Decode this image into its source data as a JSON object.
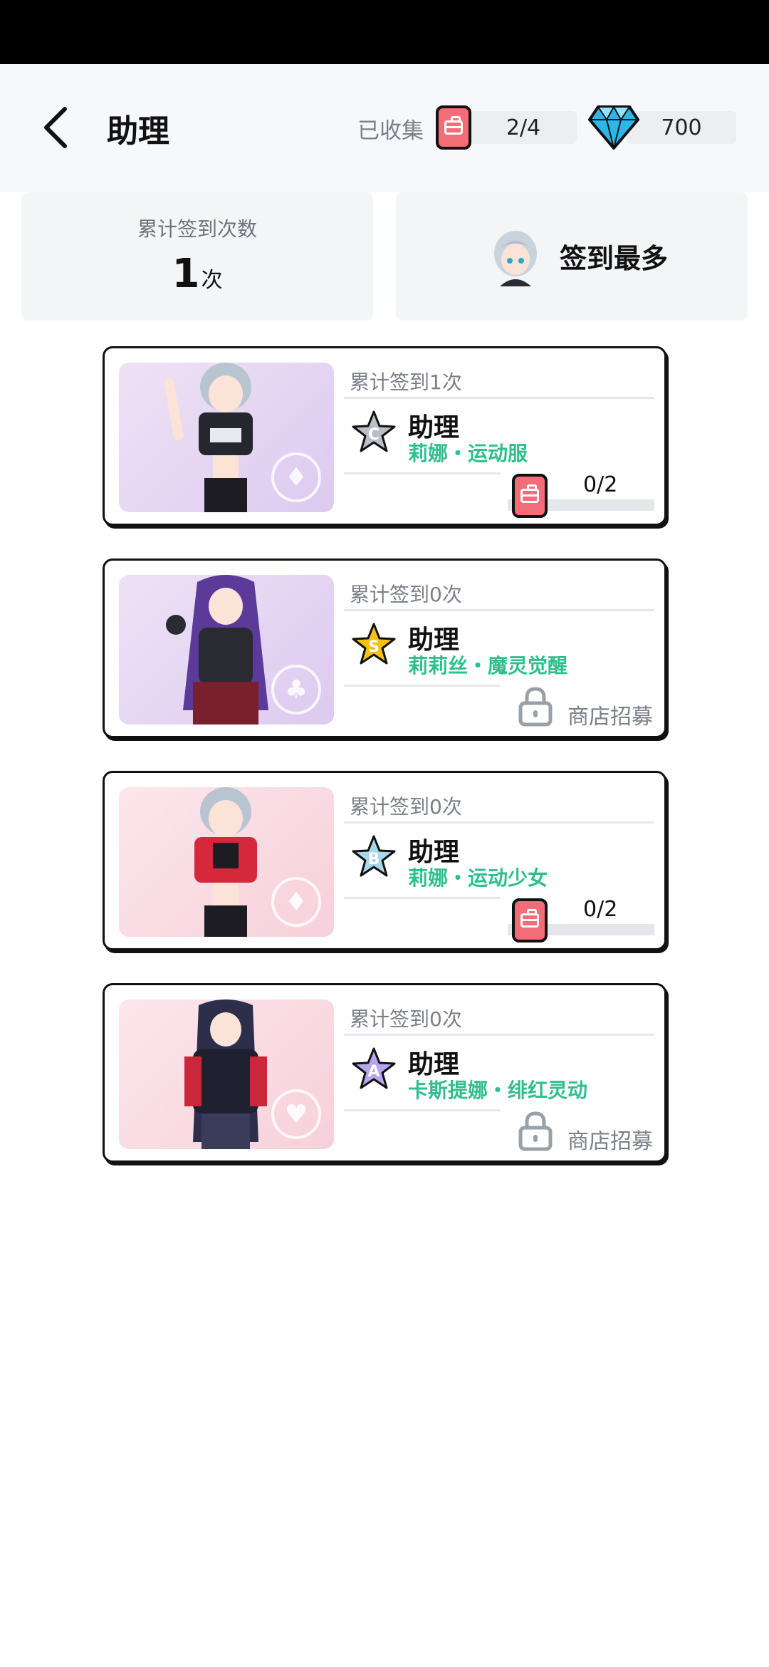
{
  "header": {
    "title": "助理",
    "collected_label": "已收集",
    "collected_count": "2/4",
    "diamonds": "700"
  },
  "stats": {
    "total_label": "累计签到次数",
    "total_value": "1",
    "total_unit": "次",
    "most_label": "签到最多"
  },
  "cards": [
    {
      "count_text": "累计签到1次",
      "rank": "C",
      "title": "助理",
      "subtitle": "莉娜・运动服",
      "progress": "0/2",
      "progress_fraction": 0,
      "locked": false
    },
    {
      "count_text": "累计签到0次",
      "rank": "S",
      "title": "助理",
      "subtitle": "莉莉丝・魔灵觉醒",
      "locked": true,
      "lock_text": "商店招募"
    },
    {
      "count_text": "累计签到0次",
      "rank": "B",
      "title": "助理",
      "subtitle": "莉娜・运动少女",
      "progress": "0/2",
      "progress_fraction": 0,
      "locked": false
    },
    {
      "count_text": "累计签到0次",
      "rank": "A",
      "title": "助理",
      "subtitle": "卡斯提娜・绯红灵动",
      "locked": true,
      "lock_text": "商店招募"
    }
  ],
  "colors": {
    "accent_green": "#2fbf8c",
    "chip_red": "#f26d78",
    "rank_C": "#b9bfc6",
    "rank_S": "#f6c20f",
    "rank_B": "#a9d6ea",
    "rank_A": "#b7a6ee"
  },
  "icons": {
    "back": "chevron-left-icon",
    "chip": "bag-chip-icon",
    "diamond": "diamond-icon",
    "lock": "lock-icon",
    "rank": "star-rank-icon"
  }
}
